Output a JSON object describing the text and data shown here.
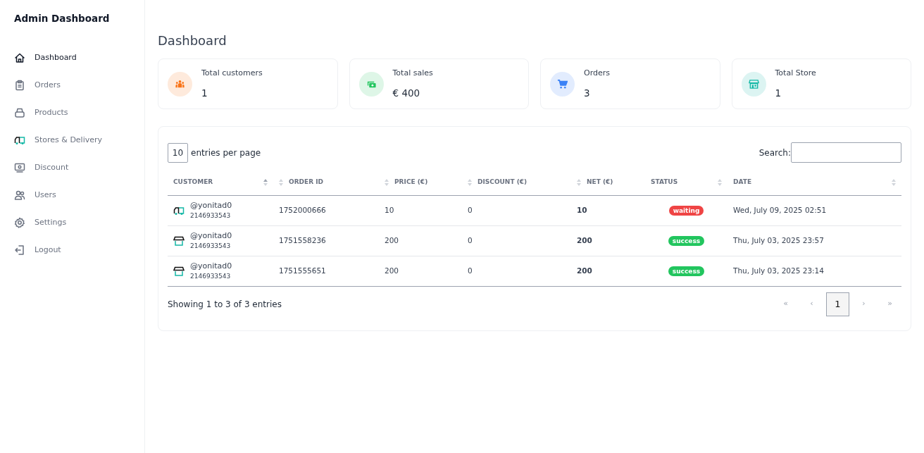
{
  "sidebar": {
    "title": "Admin Dashboard",
    "items": [
      {
        "label": "Dashboard",
        "selected": true
      },
      {
        "label": "Orders",
        "selected": false
      },
      {
        "label": "Products",
        "selected": false
      },
      {
        "label": "Stores & Delivery",
        "selected": false
      },
      {
        "label": "Discount",
        "selected": false
      },
      {
        "label": "Users",
        "selected": false
      },
      {
        "label": "Settings",
        "selected": false
      },
      {
        "label": "Logout",
        "selected": false
      }
    ]
  },
  "page_title": "Dashboard",
  "stats": [
    {
      "label": "Total customers",
      "value": "1",
      "color": "#f97316"
    },
    {
      "label": "Total sales",
      "value": "€ 400",
      "color": "#22c55e"
    },
    {
      "label": "Orders",
      "value": "3",
      "color": "#3b82f6"
    },
    {
      "label": "Total Store",
      "value": "1",
      "color": "#14b8a6"
    }
  ],
  "table": {
    "page_size": "10",
    "page_size_label": "entries per page",
    "search_label": "Search:",
    "columns": [
      {
        "label": "CUSTOMER",
        "kind": "text",
        "sorted": true
      },
      {
        "label": "ORDER ID",
        "kind": "numeric",
        "sorted": false
      },
      {
        "label": "PRICE (€)",
        "kind": "numeric",
        "sorted": false
      },
      {
        "label": "DISCOUNT (€)",
        "kind": "numeric",
        "sorted": false
      },
      {
        "label": "NET (€)",
        "kind": "numeric",
        "sorted": false
      },
      {
        "label": "STATUS",
        "kind": "text",
        "sorted": false
      },
      {
        "label": "DATE",
        "kind": "text",
        "sorted": false
      }
    ],
    "rows": [
      {
        "kind": "delivery",
        "name": "@yonitad0",
        "phone": "2146933543",
        "order_id": "1752000666",
        "price": "10",
        "discount": "0",
        "net": "10",
        "status": "waiting",
        "color": "#ef4444",
        "date": "Wed, July 09, 2025 02:51"
      },
      {
        "kind": "store",
        "name": "@yonitad0",
        "phone": "2146933543",
        "order_id": "1751558236",
        "price": "200",
        "discount": "0",
        "net": "200",
        "status": "success",
        "color": "#22c55e",
        "date": "Thu, July 03, 2025 23:57"
      },
      {
        "kind": "store",
        "name": "@yonitad0",
        "phone": "2146933543",
        "order_id": "1751555651",
        "price": "200",
        "discount": "0",
        "net": "200",
        "status": "success",
        "color": "#22c55e",
        "date": "Thu, July 03, 2025 23:14"
      }
    ],
    "info": "Showing 1 to 3 of 3 entries",
    "pagination": [
      {
        "label": "«",
        "selected": false,
        "disabled": true
      },
      {
        "label": "‹",
        "selected": false,
        "disabled": true
      },
      {
        "label": "1",
        "selected": true,
        "disabled": false
      },
      {
        "label": "›",
        "selected": false,
        "disabled": true
      },
      {
        "label": "»",
        "selected": false,
        "disabled": true
      }
    ]
  }
}
